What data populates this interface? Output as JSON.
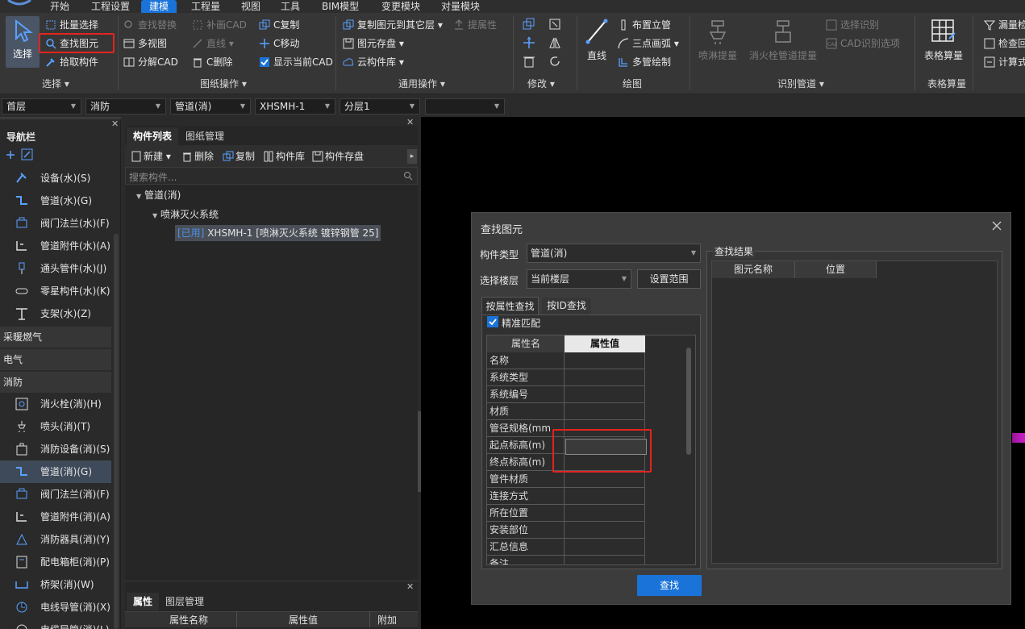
{
  "menu": {
    "items": [
      "开始",
      "工程设置",
      "建模",
      "工程量",
      "视图",
      "工具",
      "BIM模型",
      "变更模块",
      "对量模块"
    ],
    "active_index": 2
  },
  "ribbon": {
    "select_group": {
      "big_label": "选择",
      "items": [
        "批量选择",
        "查找图元",
        "拾取构件"
      ],
      "group_label": "选择"
    },
    "drawing_ops": {
      "col1": [
        "查找替换",
        "多视图",
        "分解CAD"
      ],
      "col2": [
        "补画CAD",
        "直线",
        "C删除"
      ],
      "col3": [
        "C复制",
        "C移动",
        "显示当前CAD"
      ],
      "group_label": "图纸操作"
    },
    "general_ops": {
      "col1": [
        "复制图元到其它层",
        "图元存盘",
        "云构件库"
      ],
      "col2": [
        "提属性"
      ],
      "group_label": "通用操作"
    },
    "modify": {
      "group_label": "修改"
    },
    "draw": {
      "big_label": "直线",
      "items": [
        "布置立管",
        "三点画弧",
        "多管绘制"
      ],
      "group_label": "绘图"
    },
    "recognize": {
      "big1": "喷淋提量",
      "big2": "消火栓管道提量",
      "items": [
        "选择识别",
        "CAD识别选项"
      ],
      "group_label": "识别管道"
    },
    "table_qty": {
      "big_label": "表格算量",
      "group_label": "表格算量"
    },
    "check": {
      "items": [
        "漏量检",
        "检查回",
        "计算式"
      ]
    }
  },
  "combos": [
    "首层",
    "消防",
    "管道(消)",
    "XHSMH-1",
    "分层1",
    ""
  ],
  "nav": {
    "title": "导航栏",
    "water_items": [
      "设备(水)(S)",
      "管道(水)(G)",
      "阀门法兰(水)(F)",
      "管道附件(水)(A)",
      "通头管件(水)(J)",
      "零星构件(水)(K)",
      "支架(水)(Z)"
    ],
    "categories": [
      "采暖燃气",
      "电气",
      "消防"
    ],
    "fire_items": [
      "消火栓(消)(H)",
      "喷头(消)(T)",
      "消防设备(消)(S)",
      "管道(消)(G)",
      "阀门法兰(消)(F)",
      "管道附件(消)(A)",
      "消防器具(消)(Y)",
      "配电箱柜(消)(P)",
      "桥架(消)(W)",
      "电线导管(消)(X)",
      "电缆导管(消)(L)"
    ],
    "selected_fire_index": 3
  },
  "comp_panel": {
    "tabs": [
      "构件列表",
      "图纸管理"
    ],
    "toolbar": [
      "新建",
      "删除",
      "复制",
      "构件库",
      "构件存盘"
    ],
    "search_placeholder": "搜索构件...",
    "tree": {
      "root": "管道(消)",
      "child": "喷淋灭火系统",
      "leaf_tag": "[已用]",
      "leaf_text": "XHSMH-1 [喷淋灭火系统 镀锌钢管 25]"
    }
  },
  "props_panel": {
    "tabs": [
      "属性",
      "图层管理"
    ],
    "headers": [
      "属性名称",
      "属性值",
      "附加"
    ]
  },
  "dialog": {
    "title": "查找图元",
    "type_label": "构件类型",
    "type_value": "管道(消)",
    "floor_label": "选择楼层",
    "floor_value": "当前楼层",
    "range_button": "设置范围",
    "tabs": [
      "按属性查找",
      "按ID查找"
    ],
    "exact_match": "精准匹配",
    "exact_checked": true,
    "grid_headers": [
      "属性名",
      "属性值"
    ],
    "rows": [
      "名称",
      "系统类型",
      "系统编号",
      "材质",
      "管径规格(mm",
      "起点标高(m)",
      "终点标高(m)",
      "管件材质",
      "连接方式",
      "所在位置",
      "安装部位",
      "汇总信息",
      "备注"
    ],
    "results_label": "查找结果",
    "results_headers": [
      "图元名称",
      "位置"
    ],
    "find_button": "查找"
  },
  "colors": {
    "accent": "#1a73d9",
    "highlight": "#e3241e",
    "pipe": "#c81ec8"
  }
}
